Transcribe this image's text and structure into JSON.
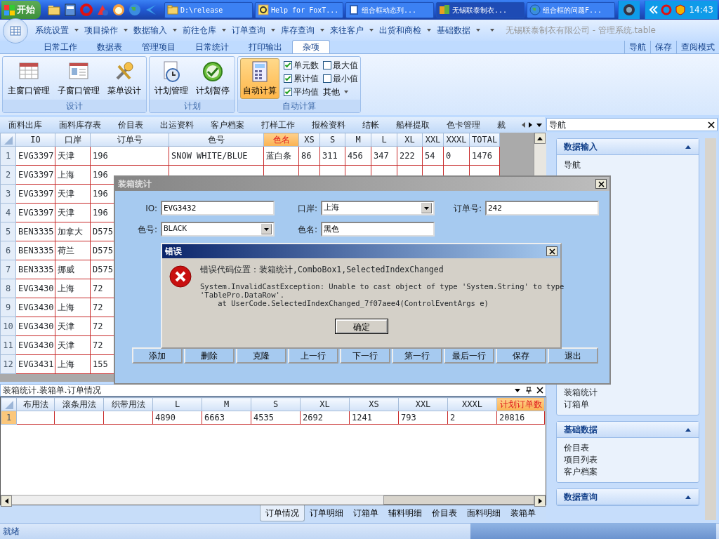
{
  "taskbar": {
    "start": "开始",
    "tasks": [
      {
        "label": "D:\\release",
        "kind": "folder",
        "selected": false
      },
      {
        "label": "Help for FoxT...",
        "kind": "help",
        "selected": false
      },
      {
        "label": "组合框动态列...",
        "kind": "doc",
        "selected": false
      },
      {
        "label": "无锡联泰制衣...",
        "kind": "app",
        "selected": true
      },
      {
        "label": "组合框的问题F...",
        "kind": "globe",
        "selected": false
      }
    ],
    "time": "14:43"
  },
  "menu": {
    "items": [
      "系统设置",
      "项目操作",
      "数据输入",
      "前往仓库",
      "订单查询",
      "库存查询",
      "来往客户",
      "出货和商检",
      "基础数据"
    ],
    "app_title": "无锡联泰制衣有限公司 - 管理系统.table"
  },
  "ribbon": {
    "tabs": [
      {
        "label": "日常工作",
        "selected": false
      },
      {
        "label": "数据表",
        "selected": false
      },
      {
        "label": "管理项目",
        "selected": false
      },
      {
        "label": "日常统计",
        "selected": false
      },
      {
        "label": "打印输出",
        "selected": false
      },
      {
        "label": "杂项",
        "selected": true
      }
    ],
    "links": [
      "导航",
      "保存",
      "查阅模式"
    ],
    "groups": [
      {
        "title": "设计",
        "buttons": [
          {
            "label": "主窗口管理",
            "kind": "table",
            "selected": false
          },
          {
            "label": "子窗口管理",
            "kind": "card",
            "selected": false
          },
          {
            "label": "菜单设计",
            "kind": "tools",
            "selected": false
          }
        ]
      },
      {
        "title": "计划",
        "buttons": [
          {
            "label": "计划管理",
            "kind": "clock",
            "selected": false
          },
          {
            "label": "计划暂停",
            "kind": "check",
            "selected": false
          }
        ]
      },
      {
        "title": "自动计算",
        "buttons": [
          {
            "label": "自动计算",
            "kind": "calc",
            "selected": true
          }
        ],
        "options": [
          {
            "label": "单元数",
            "checked": true
          },
          {
            "label": "最大值",
            "checked": false
          },
          {
            "label": "累计值",
            "checked": true
          },
          {
            "label": "最小值",
            "checked": false
          },
          {
            "label": "平均值",
            "checked": true
          }
        ],
        "dropdown": "其他"
      }
    ]
  },
  "doc_tabs": [
    "面料出库",
    "面料库存表",
    "价目表",
    "出运资料",
    "客户档案",
    "打样工作",
    "报检资料",
    "结帐",
    "船样提取",
    "色卡管理",
    "裁"
  ],
  "grid": {
    "columns": [
      {
        "label": "IO",
        "selected": false
      },
      {
        "label": "口岸",
        "selected": false
      },
      {
        "label": "订单号",
        "selected": false
      },
      {
        "label": "色号",
        "selected": false
      },
      {
        "label": "色名",
        "selected": true
      },
      {
        "label": "XS",
        "selected": false
      },
      {
        "label": "S",
        "selected": false
      },
      {
        "label": "M",
        "selected": false
      },
      {
        "label": "L",
        "selected": false
      },
      {
        "label": "XL",
        "selected": false
      },
      {
        "label": "XXL",
        "selected": false
      },
      {
        "label": "XXXL",
        "selected": false
      },
      {
        "label": "TOTAL",
        "selected": false
      }
    ],
    "rows": [
      {
        "num": "1",
        "cells": [
          "EVG3397",
          "天津",
          "196",
          "SNOW WHITE/BLUE",
          "蓝白条",
          "86",
          "311",
          "456",
          "347",
          "222",
          "54",
          "0",
          "1476"
        ]
      },
      {
        "num": "2",
        "cells": [
          "EVG3397",
          "上海",
          "196"
        ]
      },
      {
        "num": "3",
        "cells": [
          "EVG3397",
          "天津",
          "196"
        ]
      },
      {
        "num": "4",
        "cells": [
          "EVG3397",
          "天津",
          "196"
        ]
      },
      {
        "num": "5",
        "cells": [
          "BEN3335",
          "加拿大",
          "D575"
        ]
      },
      {
        "num": "6",
        "cells": [
          "BEN3335",
          "荷兰",
          "D575"
        ]
      },
      {
        "num": "7",
        "cells": [
          "BEN3335",
          "挪威",
          "D575"
        ]
      },
      {
        "num": "8",
        "cells": [
          "EVG3430",
          "上海",
          "72"
        ]
      },
      {
        "num": "9",
        "cells": [
          "EVG3430",
          "上海",
          "72"
        ]
      },
      {
        "num": "10",
        "cells": [
          "EVG3430",
          "天津",
          "72"
        ]
      },
      {
        "num": "11",
        "cells": [
          "EVG3430",
          "天津",
          "72"
        ]
      },
      {
        "num": "12",
        "cells": [
          "EVG3431",
          "上海",
          "155"
        ]
      }
    ]
  },
  "nav": {
    "title": "导航",
    "groups": [
      {
        "title": "数据输入",
        "items": [
          "导航"
        ],
        "more_items": [
          "装箱统计",
          "订箱单"
        ]
      },
      {
        "title": "基础数据",
        "items": [
          "价目表",
          "项目列表",
          "客户档案"
        ]
      },
      {
        "title": "数据查询"
      }
    ]
  },
  "bottom": {
    "title": "装箱统计.装箱单.订单情况",
    "columns": [
      {
        "label": "布用法",
        "selected": false
      },
      {
        "label": "滚条用法",
        "selected": false
      },
      {
        "label": "织带用法",
        "selected": false
      },
      {
        "label": "L",
        "selected": false
      },
      {
        "label": "M",
        "selected": false
      },
      {
        "label": "S",
        "selected": false
      },
      {
        "label": "XL",
        "selected": false
      },
      {
        "label": "XS",
        "selected": false
      },
      {
        "label": "XXL",
        "selected": false
      },
      {
        "label": "XXXL",
        "selected": false
      },
      {
        "label": "计划订单数",
        "selected": true
      }
    ],
    "rows": [
      {
        "num": "1",
        "selected": true,
        "cells": [
          "",
          "",
          "",
          "4890",
          "6663",
          "4535",
          "2692",
          "1241",
          "793",
          "2",
          "20816"
        ]
      }
    ],
    "tabs": [
      {
        "label": "订单情况",
        "selected": true
      },
      {
        "label": "订单明细",
        "selected": false
      },
      {
        "label": "订箱单",
        "selected": false
      },
      {
        "label": "辅料明细",
        "selected": false
      },
      {
        "label": "价目表",
        "selected": false
      },
      {
        "label": "面料明细",
        "selected": false
      },
      {
        "label": "装箱单",
        "selected": false
      }
    ]
  },
  "status": "就绪",
  "packing_dialog": {
    "title": "装箱统计",
    "fields": [
      {
        "label": "IO:",
        "value": "EVG3432",
        "kind": "text"
      },
      {
        "label": "口岸:",
        "value": "上海",
        "kind": "combo"
      },
      {
        "label": "订单号:",
        "value": "242",
        "kind": "text"
      },
      {
        "label": "色号:",
        "value": "BLACK",
        "kind": "combo"
      },
      {
        "label": "色名:",
        "value": "黑色",
        "kind": "text"
      }
    ],
    "buttons": [
      "添加",
      "删除",
      "克隆",
      "上一行",
      "下一行",
      "第一行",
      "最后一行",
      "保存",
      "退出"
    ]
  },
  "error_dialog": {
    "title": "错误",
    "location": "错误代码位置：装箱统计,ComboBox1,SelectedIndexChanged",
    "message": [
      "System.InvalidCastException: Unable to cast object of type 'System.String' to type",
      "'TablePro.DataRow'.",
      "    at UserCode.SelectedIndexChanged_7f07aee4(ControlEventArgs e)"
    ],
    "ok": "确定"
  }
}
